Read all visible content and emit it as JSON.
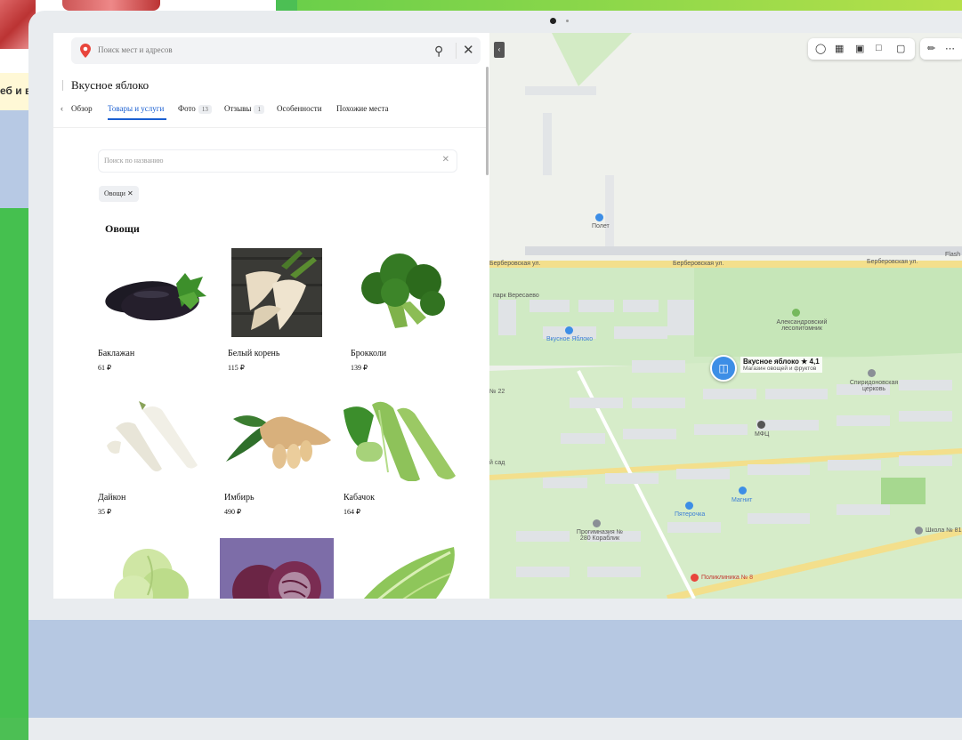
{
  "background": {
    "side_text": "еб и в"
  },
  "search": {
    "placeholder": "Поиск мест и адресов"
  },
  "place": {
    "title": "Вкусное яблоко"
  },
  "tabs": [
    {
      "label": "Обзор",
      "badge": ""
    },
    {
      "label": "Товары и услуги",
      "badge": "",
      "active": true
    },
    {
      "label": "Фото",
      "badge": "13"
    },
    {
      "label": "Отзывы",
      "badge": "1"
    },
    {
      "label": "Особенности",
      "badge": ""
    },
    {
      "label": "Похожие места",
      "badge": ""
    }
  ],
  "filter": {
    "placeholder": "Поиск по названию",
    "chip": "Овощи ✕"
  },
  "section_title": "Овощи",
  "products": [
    {
      "name": "Баклажан",
      "price": "61 ₽",
      "icon": "eggplant-image"
    },
    {
      "name": "Белый корень",
      "price": "115 ₽",
      "icon": "parsnip-image"
    },
    {
      "name": "Брокколи",
      "price": "139 ₽",
      "icon": "broccoli-image"
    },
    {
      "name": "Дайкон",
      "price": "35 ₽",
      "icon": "daikon-image"
    },
    {
      "name": "Имбирь",
      "price": "490 ₽",
      "icon": "ginger-image"
    },
    {
      "name": "Кабачок",
      "price": "164 ₽",
      "icon": "zucchini-image"
    },
    {
      "name": "",
      "price": "",
      "icon": "cabbage-image"
    },
    {
      "name": "",
      "price": "",
      "icon": "red-cabbage-image"
    },
    {
      "name": "",
      "price": "",
      "icon": "chinese-cabbage-image"
    }
  ],
  "map": {
    "poi": {
      "name": "Вкусное яблоко ★ 4,1",
      "subtitle": "Магазин овощей и фруктов"
    },
    "labels": {
      "street1": "Берберовская ул.",
      "street2": "Берберовская ул.",
      "street3": "Берберовская ул.",
      "park": "Александровский лесопитомник",
      "polet": "Полет",
      "magnit": "Магнит",
      "pyaterochka": "Пятерочка",
      "church": "Спиридоновская церковь",
      "school": "Школа № 81",
      "progymnasium": "Прогимназия № 280 Кораблик",
      "clinic": "Поликлиника № 8",
      "mfc": "МФЦ",
      "square": "парк Вересаево",
      "small_poi": "Вкусное Яблоко",
      "flash": "Flash",
      "kids": "й сад",
      "street_no": "№ 22"
    },
    "colors": {
      "park": "#cfe9c2",
      "road": "#f6e39a",
      "building": "#dfe3e7",
      "poi_blue": "#3d8ee6"
    }
  }
}
